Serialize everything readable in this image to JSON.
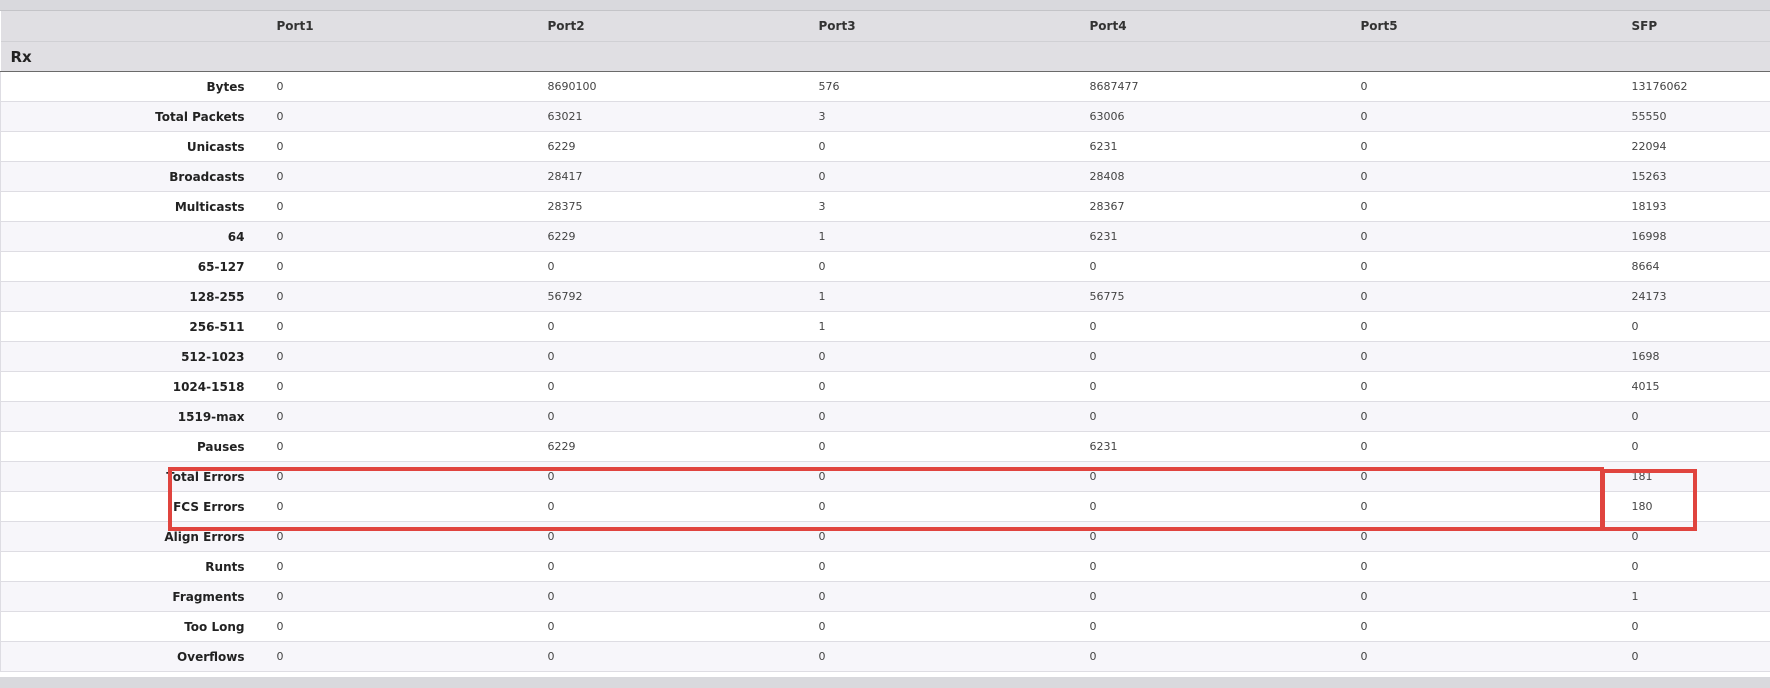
{
  "table": {
    "columns": [
      "",
      "Port1",
      "Port2",
      "Port3",
      "Port4",
      "Port5",
      "SFP"
    ],
    "section_title": "Rx",
    "rows": [
      {
        "label": "Bytes",
        "values": [
          "0",
          "8690100",
          "576",
          "8687477",
          "0",
          "13176062"
        ]
      },
      {
        "label": "Total Packets",
        "values": [
          "0",
          "63021",
          "3",
          "63006",
          "0",
          "55550"
        ]
      },
      {
        "label": "Unicasts",
        "values": [
          "0",
          "6229",
          "0",
          "6231",
          "0",
          "22094"
        ]
      },
      {
        "label": "Broadcasts",
        "values": [
          "0",
          "28417",
          "0",
          "28408",
          "0",
          "15263"
        ]
      },
      {
        "label": "Multicasts",
        "values": [
          "0",
          "28375",
          "3",
          "28367",
          "0",
          "18193"
        ]
      },
      {
        "label": "64",
        "values": [
          "0",
          "6229",
          "1",
          "6231",
          "0",
          "16998"
        ]
      },
      {
        "label": "65-127",
        "values": [
          "0",
          "0",
          "0",
          "0",
          "0",
          "8664"
        ]
      },
      {
        "label": "128-255",
        "values": [
          "0",
          "56792",
          "1",
          "56775",
          "0",
          "24173"
        ]
      },
      {
        "label": "256-511",
        "values": [
          "0",
          "0",
          "1",
          "0",
          "0",
          "0"
        ]
      },
      {
        "label": "512-1023",
        "values": [
          "0",
          "0",
          "0",
          "0",
          "0",
          "1698"
        ]
      },
      {
        "label": "1024-1518",
        "values": [
          "0",
          "0",
          "0",
          "0",
          "0",
          "4015"
        ]
      },
      {
        "label": "1519-max",
        "values": [
          "0",
          "0",
          "0",
          "0",
          "0",
          "0"
        ]
      },
      {
        "label": "Pauses",
        "values": [
          "0",
          "6229",
          "0",
          "6231",
          "0",
          "0"
        ]
      },
      {
        "label": "Total Errors",
        "values": [
          "0",
          "0",
          "0",
          "0",
          "0",
          "181"
        ]
      },
      {
        "label": "FCS Errors",
        "values": [
          "0",
          "0",
          "0",
          "0",
          "0",
          "180"
        ]
      },
      {
        "label": "Align Errors",
        "values": [
          "0",
          "0",
          "0",
          "0",
          "0",
          "0"
        ]
      },
      {
        "label": "Runts",
        "values": [
          "0",
          "0",
          "0",
          "0",
          "0",
          "0"
        ]
      },
      {
        "label": "Fragments",
        "values": [
          "0",
          "0",
          "0",
          "0",
          "0",
          "1"
        ]
      },
      {
        "label": "Too Long",
        "values": [
          "0",
          "0",
          "0",
          "0",
          "0",
          "0"
        ]
      },
      {
        "label": "Overflows",
        "values": [
          "0",
          "0",
          "0",
          "0",
          "0",
          "0"
        ]
      }
    ]
  },
  "highlight": {
    "color": "#e0443e",
    "rows": [
      "Total Errors",
      "FCS Errors"
    ],
    "column": "SFP"
  }
}
